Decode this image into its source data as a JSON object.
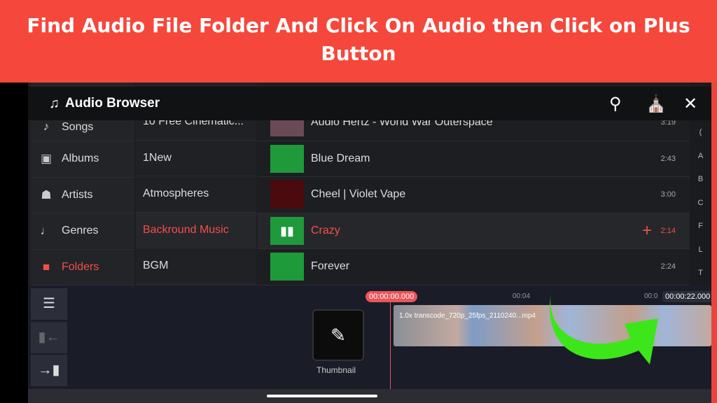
{
  "banner": {
    "text": "Find Audio File Folder And Click On Audio then Click on Plus Button"
  },
  "header": {
    "title": "Audio Browser",
    "icons": [
      "music-note-icon",
      "search-icon",
      "store-icon",
      "close-icon"
    ]
  },
  "categories": [
    {
      "label": "Songs",
      "icon": "music-note-icon"
    },
    {
      "label": "Albums",
      "icon": "album-icon"
    },
    {
      "label": "Artists",
      "icon": "artist-icon"
    },
    {
      "label": "Genres",
      "icon": "guitar-icon"
    },
    {
      "label": "Folders",
      "icon": "folder-icon",
      "selected": true
    }
  ],
  "folders": [
    "10 Free Cinematic...",
    "1New",
    "Atmospheres",
    "Backround Music",
    "BGM"
  ],
  "selected_folder": "Backround Music",
  "tracks": [
    {
      "title": "Audio Hertz - World War Outerspace",
      "duration": "3:19",
      "thumb": "#6a4a55"
    },
    {
      "title": "Blue Dream",
      "duration": "2:43",
      "thumb": "#1f9a3a"
    },
    {
      "title": "Cheel | Violet Vape",
      "duration": "3:00",
      "thumb": "#4a0a0e"
    },
    {
      "title": "Crazy",
      "duration": "2:14",
      "thumb": "#1f9a3a",
      "selected": true
    },
    {
      "title": "Forever",
      "duration": "2:24",
      "thumb": "#1f9a3a"
    }
  ],
  "index_letters": [
    "(",
    "A",
    "B",
    "C",
    "F",
    "L",
    "T"
  ],
  "timeline": {
    "current_time": "00:00:00.000",
    "total_time": "00:00:22.000",
    "tick_4": "00:04",
    "tick_8": "00:0",
    "clip_name": "1.0x transcode_720p_25fps_2110240...mp4",
    "thumbnail_label": "Thumbnail"
  },
  "colors": {
    "banner": "#f5473b",
    "accent": "#f0504a",
    "arrow": "#3de61a"
  }
}
